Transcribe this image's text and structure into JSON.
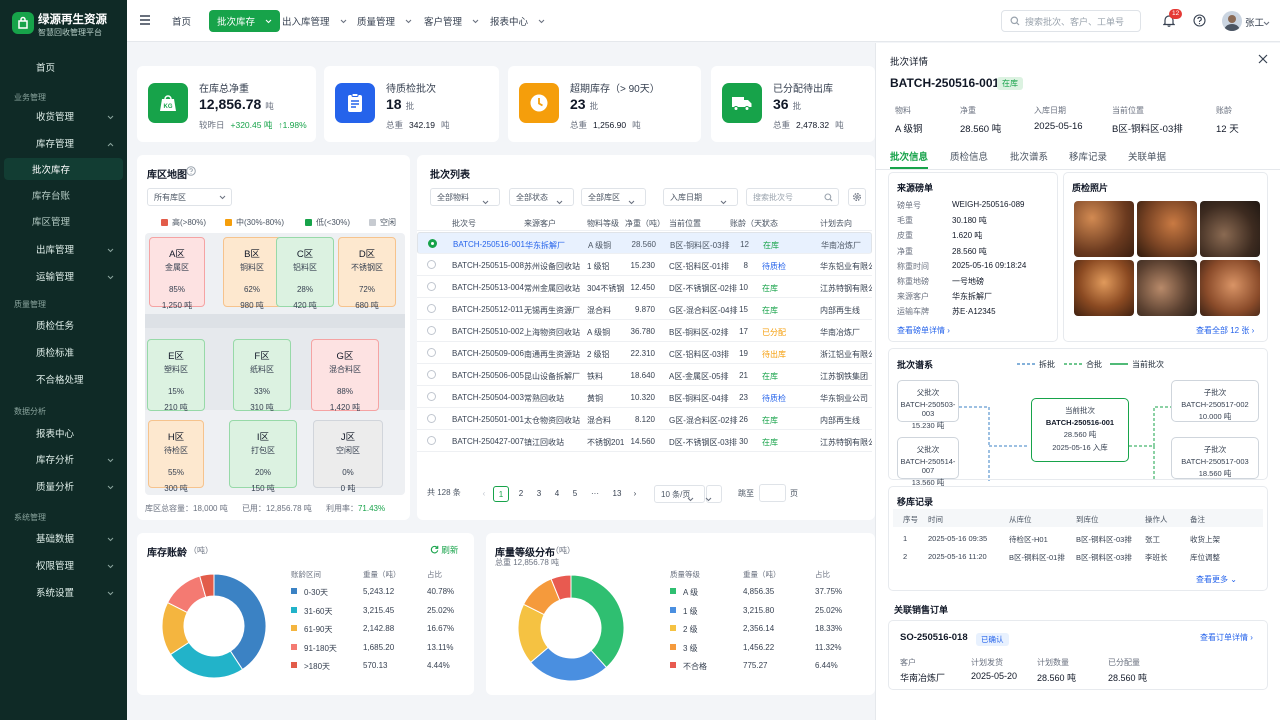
{
  "brand": {
    "name": "绿源再生资源",
    "subtitle": "智慧回收管理平台"
  },
  "sidebar": {
    "items": [
      {
        "label": "首页",
        "icon": "home-icon"
      },
      {
        "section": "业务管理"
      },
      {
        "label": "收货管理",
        "icon": "clipboard-icon"
      },
      {
        "label": "库存管理",
        "icon": "warehouse-icon",
        "expanded": true
      },
      {
        "label": "批次库存",
        "sub": true,
        "active": true
      },
      {
        "label": "库存台账",
        "sub": true
      },
      {
        "label": "库区管理",
        "sub": true
      },
      {
        "label": "出库管理",
        "icon": "outbound-icon"
      },
      {
        "label": "运输管理",
        "icon": "truck-icon"
      },
      {
        "section": "质量管理"
      },
      {
        "label": "质检任务",
        "icon": "check-task-icon"
      },
      {
        "label": "质检标准",
        "icon": "shield-icon"
      },
      {
        "label": "不合格处理",
        "icon": "ban-icon"
      },
      {
        "section": "数据分析"
      },
      {
        "label": "报表中心",
        "icon": "report-icon"
      },
      {
        "label": "库存分析",
        "icon": "analysis-icon"
      },
      {
        "label": "质量分析",
        "icon": "quality-icon"
      },
      {
        "section": "系统管理"
      },
      {
        "label": "基础数据",
        "icon": "database-icon"
      },
      {
        "label": "权限管理",
        "icon": "lock-icon"
      },
      {
        "label": "系统设置",
        "icon": "gear-icon"
      }
    ]
  },
  "topbar": {
    "tabs": [
      "首页",
      "批次库存",
      "出入库管理",
      "质量管理",
      "客户管理",
      "报表中心"
    ],
    "search_placeholder": "搜索批次、客户、工单号",
    "notif_count": "12",
    "user": "张工"
  },
  "kpis": [
    {
      "label": "在库总净重",
      "value": "12,856.78",
      "unit": "吨",
      "sub1": "较昨日",
      "sub2": "+320.45 吨",
      "sub3": "↑1.98%",
      "color": "#17a34a"
    },
    {
      "label": "待质检批次",
      "value": "18",
      "unit": "批",
      "sub1": "总重",
      "sub2": "342.19",
      "sub3": "吨",
      "color": "#2563eb"
    },
    {
      "label": "超期库存（> 90天）",
      "value": "23",
      "unit": "批",
      "sub1": "总重",
      "sub2": "1,256.90",
      "sub3": "吨",
      "color": "#f59e0b"
    },
    {
      "label": "已分配待出库",
      "value": "36",
      "unit": "批",
      "sub1": "总重",
      "sub2": "2,478.32",
      "sub3": "吨",
      "color": "#17a34a"
    }
  ],
  "map": {
    "title": "库区地图",
    "filter": "所有库区",
    "legend": [
      "高(>80%)",
      "中(30%-80%)",
      "低(<30%)",
      "空闲"
    ],
    "zones": [
      {
        "name": "A区",
        "desc": "金属区",
        "pct": "85%",
        "weight": "1,250 吨",
        "level": "red"
      },
      {
        "name": "B区",
        "desc": "铜料区",
        "pct": "62%",
        "weight": "980 吨",
        "level": "org"
      },
      {
        "name": "C区",
        "desc": "铝料区",
        "pct": "28%",
        "weight": "420 吨",
        "level": "grn"
      },
      {
        "name": "D区",
        "desc": "不锈钢区",
        "pct": "72%",
        "weight": "680 吨",
        "level": "org"
      },
      {
        "name": "E区",
        "desc": "塑料区",
        "pct": "15%",
        "weight": "210 吨",
        "level": "grn"
      },
      {
        "name": "F区",
        "desc": "纸料区",
        "pct": "33%",
        "weight": "310 吨",
        "level": "grn"
      },
      {
        "name": "G区",
        "desc": "混合料区",
        "pct": "88%",
        "weight": "1,420 吨",
        "level": "red"
      },
      {
        "name": "H区",
        "desc": "待检区",
        "pct": "55%",
        "weight": "300 吨",
        "level": "org"
      },
      {
        "name": "I区",
        "desc": "打包区",
        "pct": "20%",
        "weight": "150 吨",
        "level": "grn"
      },
      {
        "name": "J区",
        "desc": "空闲区",
        "pct": "0%",
        "weight": "0 吨",
        "level": "gry"
      }
    ],
    "footer": {
      "cap_label": "库区总容量：",
      "cap": "18,000 吨",
      "used_label": "已用：",
      "used": "12,856.78 吨",
      "rate_label": "利用率：",
      "rate": "71.43%"
    }
  },
  "batch": {
    "title": "批次列表",
    "filters": [
      "全部物料",
      "全部状态",
      "全部库区",
      "入库日期"
    ],
    "search_placeholder": "搜索批次号",
    "columns": [
      "批次号",
      "来源客户",
      "物料等级",
      "净重（吨）",
      "当前位置",
      "账龄（天）",
      "状态",
      "计划去向"
    ],
    "rows": [
      [
        "BATCH-250516-001",
        "华东拆解厂",
        "A 级铜",
        "28.560",
        "B区-铜料区-03排",
        "12",
        "在库",
        "华南冶炼厂"
      ],
      [
        "BATCH-250515-008",
        "苏州设备回收站",
        "1 级铝",
        "15.230",
        "C区-铝料区-01排",
        "8",
        "待质检",
        "华东铝业有限公司"
      ],
      [
        "BATCH-250513-004",
        "常州金属回收站",
        "304不锈钢",
        "12.450",
        "D区-不锈钢区-02排",
        "10",
        "在库",
        "江苏特钢有限公司"
      ],
      [
        "BATCH-250512-011",
        "无锡再生资源厂",
        "混合料",
        "9.870",
        "G区-混合料区-04排",
        "15",
        "在库",
        "内部再生线"
      ],
      [
        "BATCH-250510-002",
        "上海物资回收站",
        "A 级铜",
        "36.780",
        "B区-铜料区-02排",
        "17",
        "已分配",
        "华南冶炼厂"
      ],
      [
        "BATCH-250509-006",
        "南通再生资源站",
        "2 级铝",
        "22.310",
        "C区-铝料区-03排",
        "19",
        "待出库",
        "浙江铝业有限公司"
      ],
      [
        "BATCH-250506-005",
        "昆山设备拆解厂",
        "铁料",
        "18.640",
        "A区-金属区-05排",
        "21",
        "在库",
        "江苏钢铁集团"
      ],
      [
        "BATCH-250504-003",
        "常熟回收站",
        "黄铜",
        "10.320",
        "B区-铜料区-04排",
        "23",
        "待质检",
        "华东铜业公司"
      ],
      [
        "BATCH-250501-001",
        "太仓物资回收站",
        "混合料",
        "8.120",
        "G区-混合料区-02排",
        "26",
        "在库",
        "内部再生线"
      ],
      [
        "BATCH-250427-007",
        "镇江回收站",
        "不锈钢201",
        "14.560",
        "D区-不锈钢区-03排",
        "30",
        "在库",
        "江苏特钢有限公司"
      ]
    ],
    "total": "共 128 条",
    "pages": [
      "1",
      "2",
      "3",
      "4",
      "5",
      "···",
      "13"
    ],
    "page_size": "10 条/页",
    "goto": "跳至",
    "goto_unit": "页"
  },
  "age_chart": {
    "title": "库存账龄",
    "unit": "（吨）",
    "refresh": "刷新",
    "headers": [
      "账龄区间",
      "重量（吨）",
      "占比"
    ],
    "chart_data": {
      "type": "pie",
      "categories": [
        "0-30天",
        "31-60天",
        "61-90天",
        "91-180天",
        ">180天"
      ],
      "values": [
        5243.12,
        3215.45,
        2142.88,
        1685.2,
        570.13
      ],
      "weights": [
        "5,243.12",
        "3,215.45",
        "2,142.88",
        "1,685.20",
        "570.13"
      ],
      "pcts": [
        "40.78%",
        "25.02%",
        "16.67%",
        "13.11%",
        "4.44%"
      ],
      "colors": [
        "#3b82c4",
        "#22b3c9",
        "#f4b53f",
        "#f47a72",
        "#e25c4a"
      ]
    }
  },
  "grade_chart": {
    "title": "库量等级分布",
    "unit": "（吨）",
    "total": "总重 12,856.78 吨",
    "headers": [
      "质量等级",
      "重量（吨）",
      "占比"
    ],
    "chart_data": {
      "type": "pie",
      "categories": [
        "A 级",
        "1 级",
        "2 级",
        "3 级",
        "不合格"
      ],
      "values": [
        4856.35,
        3215.8,
        2356.14,
        1456.22,
        775.27
      ],
      "weights": [
        "4,856.35",
        "3,215.80",
        "2,356.14",
        "1,456.22",
        "775.27"
      ],
      "pcts": [
        "37.75%",
        "25.02%",
        "18.33%",
        "11.32%",
        "6.44%"
      ],
      "colors": [
        "#2fbf71",
        "#4a8fe0",
        "#f5c242",
        "#f59a3c",
        "#e85a50"
      ]
    }
  },
  "detail": {
    "header": "批次详情",
    "batch_no": "BATCH-250516-001",
    "status": "在库",
    "fields": [
      [
        "物料",
        "A 级铜"
      ],
      [
        "净重",
        "28.560 吨"
      ],
      [
        "入库日期",
        "2025-05-16"
      ],
      [
        "当前位置",
        "B区-铜料区-03排"
      ],
      [
        "账龄",
        "12 天"
      ]
    ],
    "tabs": [
      "批次信息",
      "质检信息",
      "批次谱系",
      "移库记录",
      "关联单据"
    ],
    "weigh": {
      "title": "来源磅单",
      "rows": [
        [
          "磅单号",
          "WEIGH-250516-089"
        ],
        [
          "毛重",
          "30.180 吨"
        ],
        [
          "皮重",
          "1.620 吨"
        ],
        [
          "净重",
          "28.560 吨"
        ],
        [
          "称重时间",
          "2025-05-16 09:18:24"
        ],
        [
          "称重地磅",
          "一号地磅"
        ],
        [
          "来源客户",
          "华东拆解厂"
        ],
        [
          "运输车牌",
          "苏E·A12345"
        ]
      ],
      "link": "查看磅单详情 ›"
    },
    "photos": {
      "title": "质检照片",
      "link": "查看全部 12 张 ›"
    },
    "lineage": {
      "title": "批次谱系",
      "legend": [
        "拆批",
        "合批",
        "当前批次"
      ],
      "parents": [
        {
          "label": "父批次",
          "id": "BATCH-250503-003",
          "w": "15.230 吨"
        },
        {
          "label": "父批次",
          "id": "BATCH-250514-007",
          "w": "13.560 吨"
        }
      ],
      "current": {
        "label": "当前批次",
        "id": "BATCH-250516-001",
        "w": "28.560 吨",
        "date": "2025-05-16 入库"
      },
      "children": [
        {
          "label": "子批次",
          "id": "BATCH-250517-002",
          "w": "10.000 吨"
        },
        {
          "label": "子批次",
          "id": "BATCH-250517-003",
          "w": "18.560 吨"
        }
      ]
    },
    "moves": {
      "title": "移库记录",
      "headers": [
        "序号",
        "时间",
        "从库位",
        "到库位",
        "操作人",
        "备注"
      ],
      "rows": [
        [
          "1",
          "2025-05-16 09:35",
          "待检区-H01",
          "B区-铜料区-03排",
          "张工",
          "收货上架"
        ],
        [
          "2",
          "2025-05-16 11:20",
          "B区-铜料区-01排",
          "B区-铜料区-03排",
          "李班长",
          "库位调整"
        ]
      ],
      "more": "查看更多 ⌄"
    },
    "order": {
      "title": "关联销售订单",
      "no": "SO-250516-018",
      "status": "已确认",
      "link": "查看订单详情 ›",
      "fields": [
        [
          "客户",
          "华南冶炼厂"
        ],
        [
          "计划发货",
          "2025-05-20"
        ],
        [
          "计划数量",
          "28.560 吨"
        ],
        [
          "已分配量",
          "28.560 吨"
        ]
      ]
    }
  }
}
